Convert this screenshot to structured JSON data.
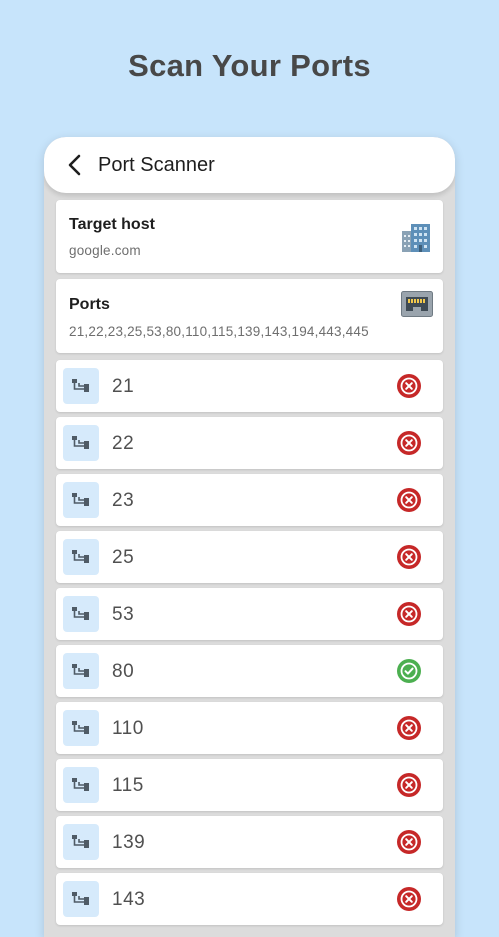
{
  "promo": {
    "title": "Scan Your Ports"
  },
  "appbar": {
    "title": "Port Scanner",
    "back_icon": "arrow-back-icon"
  },
  "target": {
    "label": "Target host",
    "value": "google.com",
    "icon": "building-icon"
  },
  "ports_card": {
    "label": "Ports",
    "value": "21,22,23,25,53,80,110,115,139,143,194,443,445",
    "icon": "ethernet-port-icon"
  },
  "colors": {
    "open": "#4caf50",
    "closed": "#c62828",
    "badge_bg": "#d6eafb",
    "page_bg": "#c7e4fb"
  },
  "results": [
    {
      "port": "21",
      "status": "closed"
    },
    {
      "port": "22",
      "status": "closed"
    },
    {
      "port": "23",
      "status": "closed"
    },
    {
      "port": "25",
      "status": "closed"
    },
    {
      "port": "53",
      "status": "closed"
    },
    {
      "port": "80",
      "status": "open"
    },
    {
      "port": "110",
      "status": "closed"
    },
    {
      "port": "115",
      "status": "closed"
    },
    {
      "port": "139",
      "status": "closed"
    },
    {
      "port": "143",
      "status": "closed"
    }
  ]
}
